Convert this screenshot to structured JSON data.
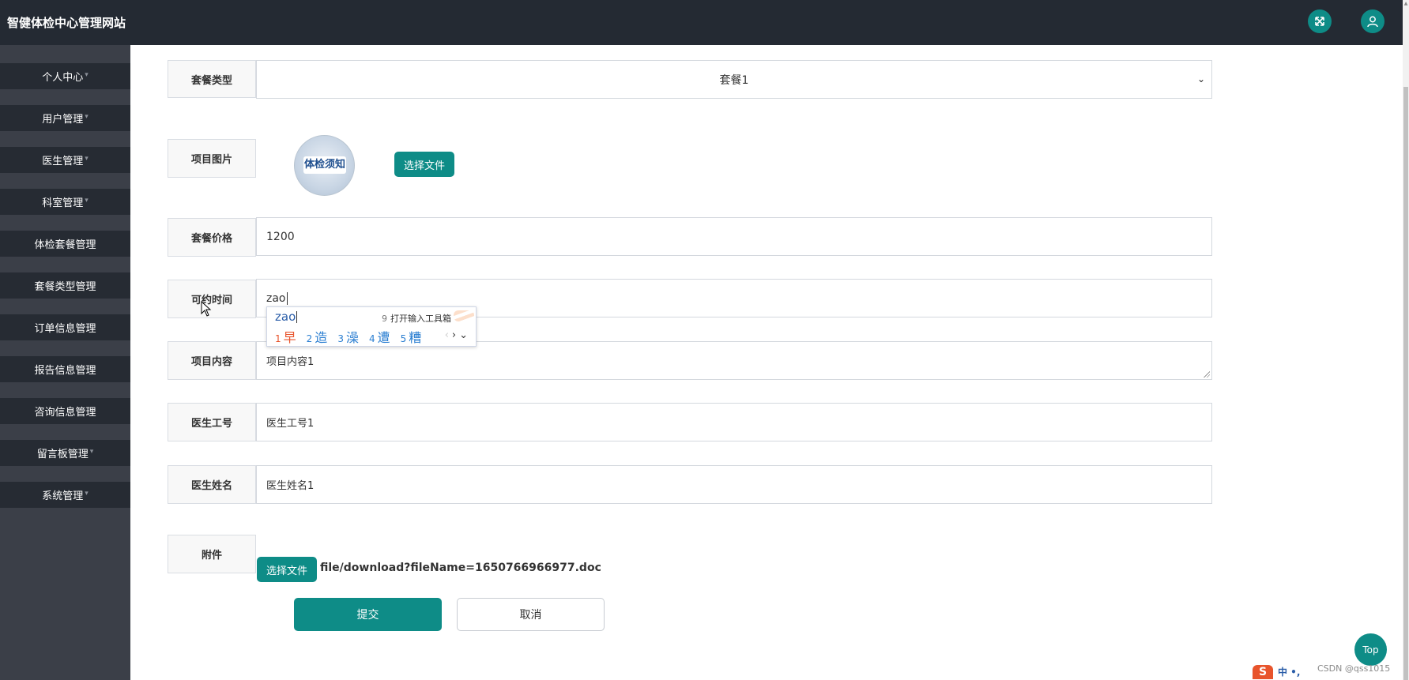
{
  "header": {
    "site_title": "智健体检中心管理网站",
    "icons": [
      "fullscreen-icon",
      "user-icon"
    ]
  },
  "sidebar": {
    "items": [
      {
        "label": "个人中心",
        "has_caret": true
      },
      {
        "label": "用户管理",
        "has_caret": true
      },
      {
        "label": "医生管理",
        "has_caret": true
      },
      {
        "label": "科室管理",
        "has_caret": true
      },
      {
        "label": "体检套餐管理",
        "has_caret": false
      },
      {
        "label": "套餐类型管理",
        "has_caret": false
      },
      {
        "label": "订单信息管理",
        "has_caret": false
      },
      {
        "label": "报告信息管理",
        "has_caret": false
      },
      {
        "label": "咨询信息管理",
        "has_caret": false
      },
      {
        "label": "留言板管理",
        "has_caret": true
      },
      {
        "label": "系统管理",
        "has_caret": true
      }
    ]
  },
  "form": {
    "package_type": {
      "label": "套餐类型",
      "value": "套餐1"
    },
    "project_image": {
      "label": "项目图片",
      "image_text": "体检须知",
      "choose_file_label": "选择文件"
    },
    "package_price": {
      "label": "套餐价格",
      "value": "1200"
    },
    "available_time": {
      "label": "可约时间",
      "value": "zao"
    },
    "project_content": {
      "label": "项目内容",
      "value": "项目内容1"
    },
    "doctor_id": {
      "label": "医生工号",
      "value": "医生工号1"
    },
    "doctor_name": {
      "label": "医生姓名",
      "value": "医生姓名1"
    },
    "attachment": {
      "label": "附件",
      "choose_file_label": "选择文件",
      "file_path": "file/download?fileName=1650766966977.doc"
    },
    "submit_label": "提交",
    "cancel_label": "取消"
  },
  "ime": {
    "composition": "zao",
    "toolbox": {
      "num": "9",
      "label": "打开输入工具箱"
    },
    "candidates": [
      {
        "num": "1",
        "text": "早"
      },
      {
        "num": "2",
        "text": "造"
      },
      {
        "num": "3",
        "text": "澡"
      },
      {
        "num": "4",
        "text": "遭"
      },
      {
        "num": "5",
        "text": "糟"
      }
    ],
    "nav": {
      "prev": "‹",
      "next": "›",
      "expand": "⌄"
    }
  },
  "back_to_top_label": "Top",
  "tray": {
    "logo": "S",
    "text": "中 •,"
  },
  "watermark": "CSDN @qss1015",
  "colors": {
    "accent": "#0e8c87",
    "topbar": "#242a33",
    "sidebar": "#3b3f48",
    "sidebar_item": "#262b33",
    "ime_highlight": "#e8542c"
  }
}
